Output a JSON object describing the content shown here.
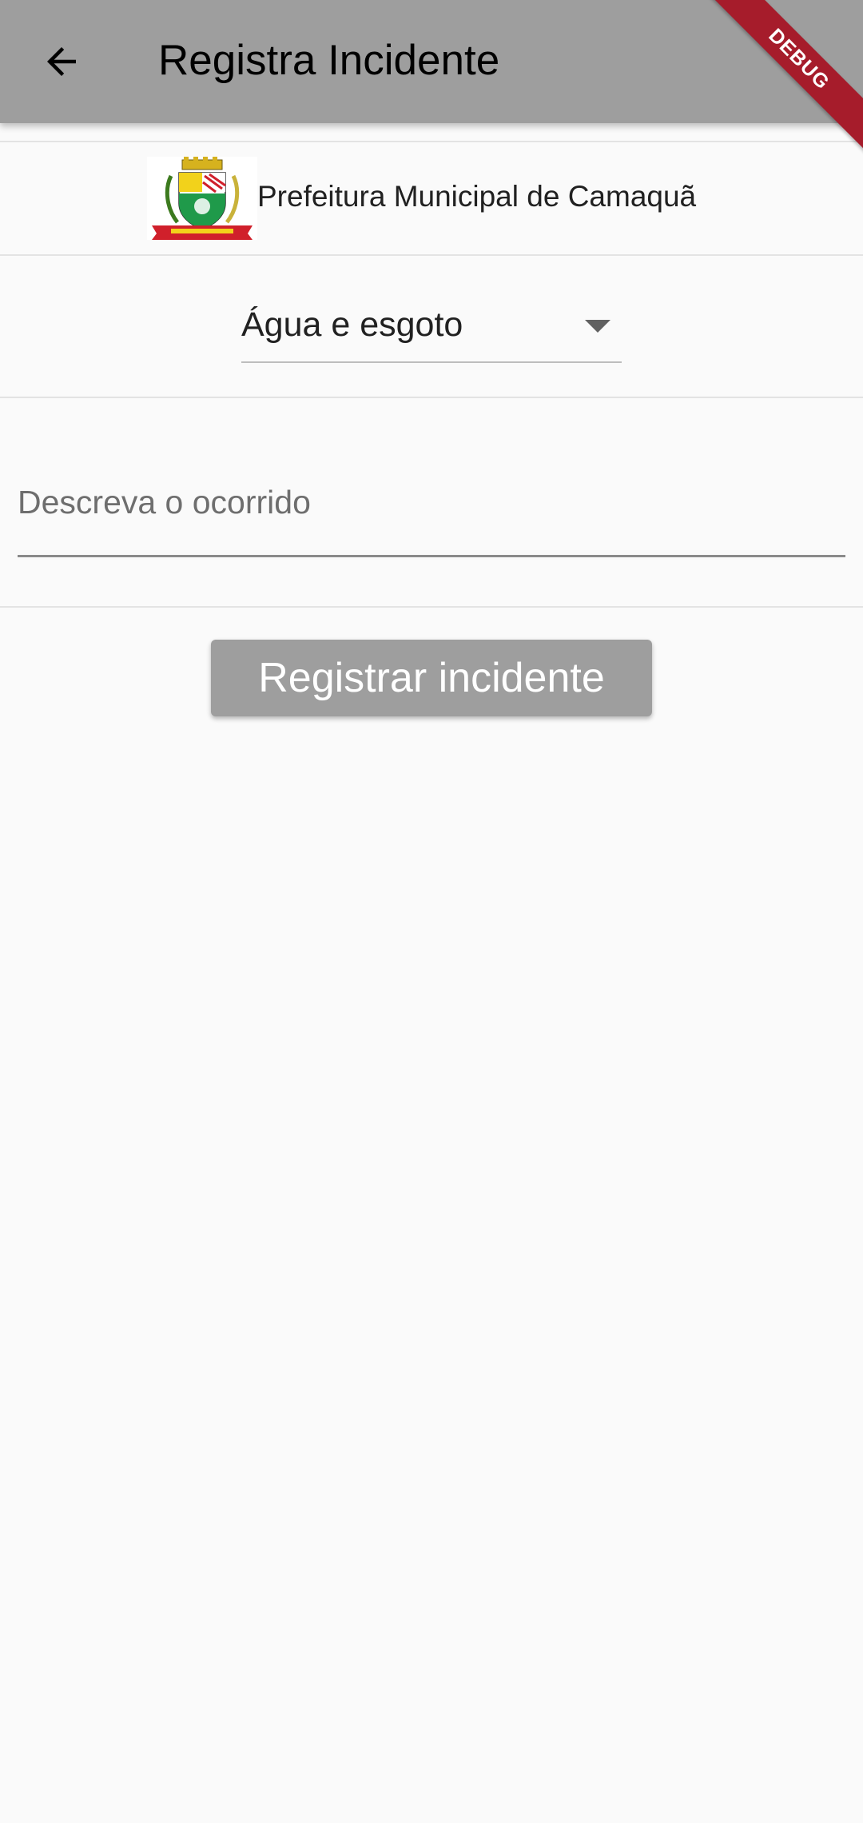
{
  "appbar": {
    "title": "Registra Incidente",
    "back_icon": "arrow-back-icon",
    "color": "#9e9e9e"
  },
  "debug_banner": {
    "label": "DEBUG",
    "color": "#a61c2b"
  },
  "organization": {
    "name": "Prefeitura Municipal de Camaquã",
    "logo": "municipal-crest-logo"
  },
  "category_dropdown": {
    "selected": "Água e esgoto",
    "icon": "arrow-drop-down-icon"
  },
  "description_field": {
    "value": "",
    "placeholder": "Descreva o ocorrido"
  },
  "submit_button": {
    "label": "Registrar incidente",
    "color": "#9e9e9e"
  }
}
